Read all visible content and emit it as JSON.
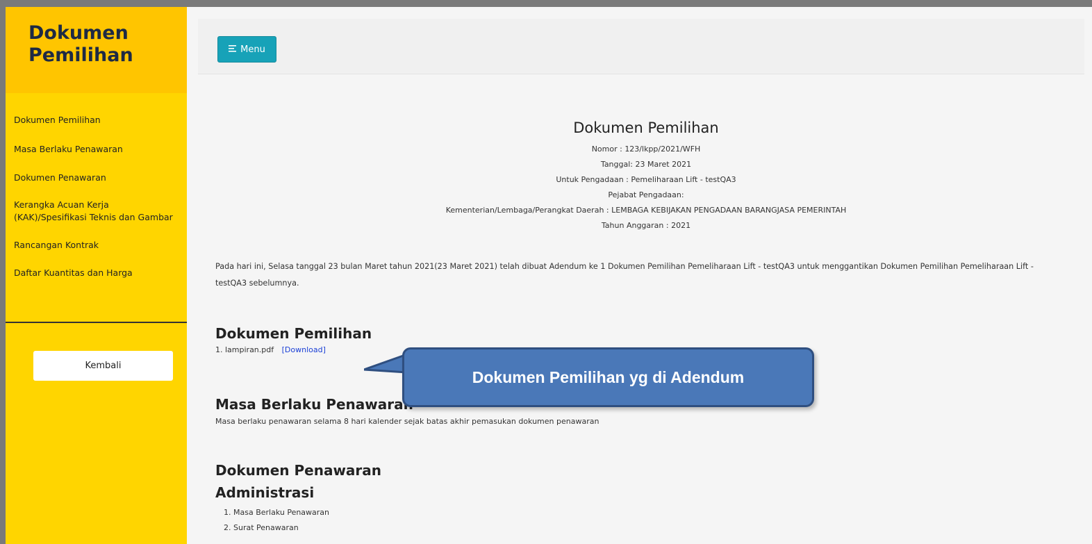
{
  "sidebar": {
    "title_line1": "Dokumen",
    "title_line2": "Pemilihan",
    "items": [
      {
        "label": "Dokumen Pemilihan"
      },
      {
        "label": "Masa Berlaku Penawaran"
      },
      {
        "label": "Dokumen Penawaran"
      },
      {
        "label": "Kerangka Acuan Kerja (KAK)/Spesifikasi Teknis dan Gambar"
      },
      {
        "label": "Rancangan Kontrak"
      },
      {
        "label": "Daftar Kuantitas dan Harga"
      }
    ],
    "back_label": "Kembali"
  },
  "topbar": {
    "menu_label": "Menu",
    "menu_icon": "menu-lines-icon"
  },
  "main": {
    "title": "Dokumen Pemilihan",
    "meta": [
      "Nomor : 123/lkpp/2021/WFH",
      "Tanggal: 23 Maret 2021",
      "Untuk Pengadaan : Pemeliharaan Lift - testQA3",
      "Pejabat Pengadaan:",
      "Kementerian/Lembaga/Perangkat Daerah : LEMBAGA KEBIJAKAN PENGADAAN BARANGJASA PEMERINTAH",
      "Tahun Anggaran : 2021"
    ],
    "paragraph": "Pada hari ini, Selasa tanggal 23 bulan Maret tahun 2021(23 Maret 2021) telah dibuat Adendum ke 1 Dokumen Pemilihan Pemeliharaan Lift - testQA3 untuk menggantikan Dokumen Pemilihan Pemeliharaan Lift - testQA3 sebelumnya.",
    "section_dokumen_pemilihan": "Dokumen Pemilihan",
    "file_name": "1. lampiran.pdf",
    "download_label": "[Download]",
    "section_masa": "Masa Berlaku Penawaran",
    "masa_text": "Masa berlaku penawaran selama 8 hari kalender sejak batas akhir pemasukan dokumen penawaran",
    "section_dokumen_penawaran": "Dokumen Penawaran",
    "section_administrasi": "Administrasi",
    "administrasi_items": [
      "1. Masa Berlaku Penawaran",
      "2. Surat Penawaran"
    ]
  },
  "callout": {
    "text": "Dokumen Pemilihan yg di Adendum"
  },
  "colors": {
    "sidebar_bg": "#ffd500",
    "sidebar_header_bg": "#ffc500",
    "menu_button": "#17a2b8",
    "link": "#1a3fd6",
    "callout_bg": "#4a78b8"
  }
}
